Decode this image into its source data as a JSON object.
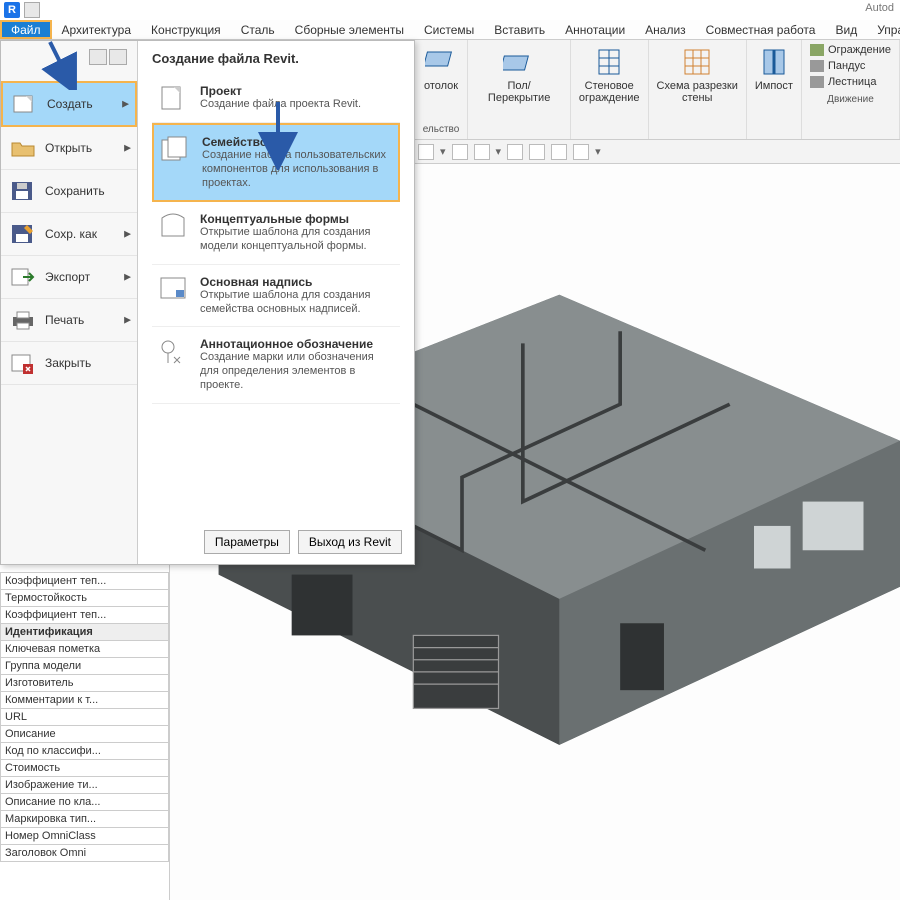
{
  "app_name": "Autod",
  "tabs": [
    "Файл",
    "Архитектура",
    "Конструкция",
    "Сталь",
    "Сборные элементы",
    "Системы",
    "Вставить",
    "Аннотации",
    "Анализ",
    "Совместная работа",
    "Вид",
    "Управлен"
  ],
  "ribbon": {
    "items": [
      {
        "label": "отолок"
      },
      {
        "label": "Пол/Перекрытие"
      },
      {
        "label": "Стеновое\nограждение"
      },
      {
        "label": "Схема разрезки\nстены"
      },
      {
        "label": "Импост"
      }
    ],
    "list": [
      "Ограждение",
      "Пандус",
      "Лестница"
    ],
    "group_label": "Движение",
    "subline": "ельство"
  },
  "app_menu": {
    "title": "Создание файла Revit.",
    "left": [
      {
        "label": "Создать",
        "hl": true
      },
      {
        "label": "Открыть"
      },
      {
        "label": "Сохранить"
      },
      {
        "label": "Сохр. как"
      },
      {
        "label": "Экспорт"
      },
      {
        "label": "Печать"
      },
      {
        "label": "Закрыть"
      }
    ],
    "options": [
      {
        "t": "Проект",
        "d": "Создание файла проекта Revit."
      },
      {
        "t": "Семейство",
        "d": "Создание набора пользовательских компонентов для использования в проектах.",
        "hl": true
      },
      {
        "t": "Концептуальные формы",
        "d": "Открытие шаблона для создания модели концептуальной формы."
      },
      {
        "t": "Основная надпись",
        "d": "Открытие шаблона для создания семейства основных надписей."
      },
      {
        "t": "Аннотационное обозначение",
        "d": "Создание марки или обозначения для определения элементов в проекте."
      }
    ],
    "buttons": [
      "Параметры",
      "Выход из Revit"
    ]
  },
  "props": {
    "rows": [
      {
        "v": "Коэффициент теп..."
      },
      {
        "v": "Термостойкость"
      },
      {
        "v": "Коэффициент теп..."
      },
      {
        "v": "Идентификация",
        "cat": true
      },
      {
        "v": "Ключевая пометка"
      },
      {
        "v": "Группа модели"
      },
      {
        "v": "Изготовитель"
      },
      {
        "v": "Комментарии к т..."
      },
      {
        "v": "URL"
      },
      {
        "v": "Описание"
      },
      {
        "v": "Код по классифи..."
      },
      {
        "v": "Стоимость"
      },
      {
        "v": "Изображение ти..."
      },
      {
        "v": "Описание по кла..."
      },
      {
        "v": "Маркировка тип..."
      },
      {
        "v": "Номер OmniClass"
      },
      {
        "v": "Заголовок Omni"
      }
    ]
  }
}
